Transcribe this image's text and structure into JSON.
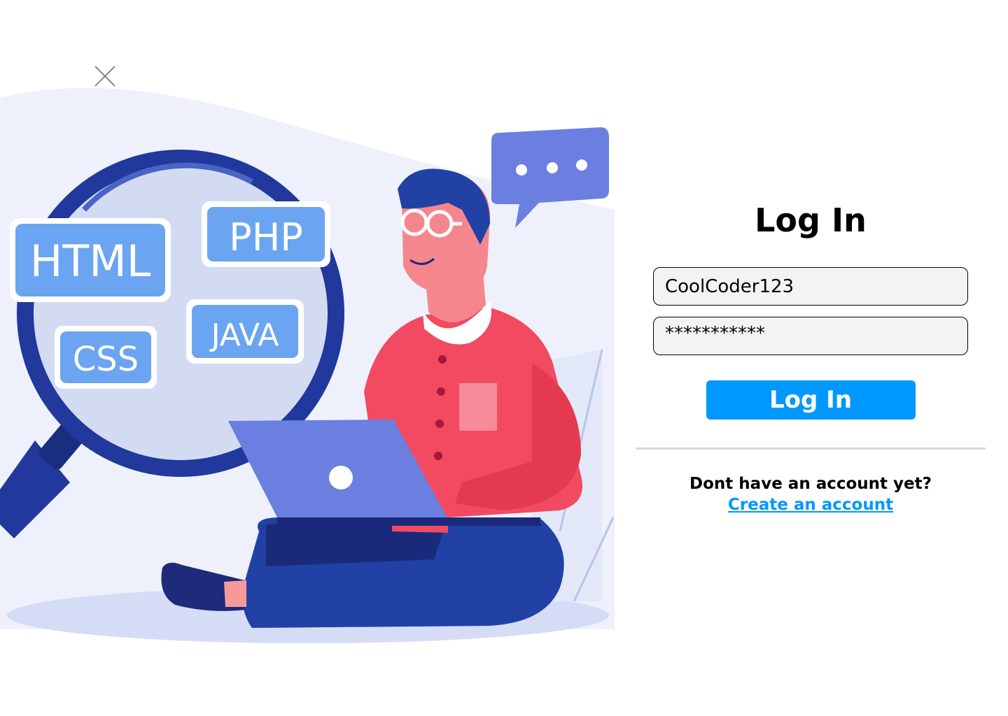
{
  "login": {
    "title": "Log In",
    "username_value": "CoolCoder123",
    "password_value": "***********",
    "submit_label": "Log In",
    "signup_prompt": "Dont have an account yet?",
    "signup_link": "Create an account"
  },
  "illustration": {
    "tags": {
      "html": "HTML",
      "php": "PHP",
      "css": "CSS",
      "java": "JAVA"
    }
  },
  "colors": {
    "accent": "#0097ff",
    "field_bg": "#f3f3f3",
    "divider": "#d9d9d9",
    "lens_ring": "#21399c",
    "tag_bg": "#6ba4f0",
    "shirt": "#f24a61",
    "laptop": "#6a7fe0"
  },
  "icons": {
    "close": "close-icon",
    "chat": "chat-bubble-icon"
  }
}
